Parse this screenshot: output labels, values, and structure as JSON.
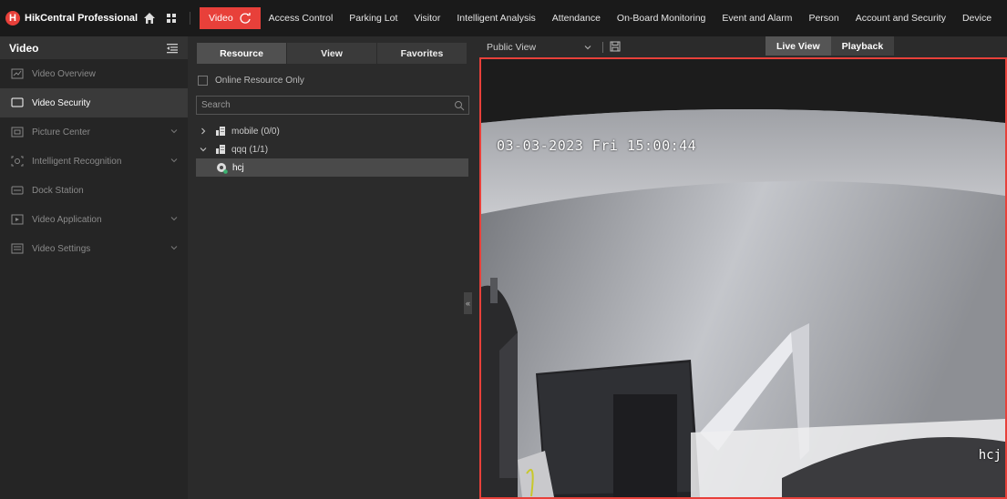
{
  "brand": {
    "logo_glyph": "H",
    "name": "HikCentral Professional"
  },
  "nav": {
    "active": "Video",
    "items": [
      "Access Control",
      "Parking Lot",
      "Visitor",
      "Intelligent Analysis",
      "Attendance",
      "On-Board Monitoring",
      "Event and Alarm",
      "Person",
      "Account and Security",
      "Device"
    ],
    "more": "···"
  },
  "sidebar": {
    "title": "Video",
    "items": [
      {
        "label": "Video Overview",
        "icon": "overview-icon",
        "expandable": false
      },
      {
        "label": "Video Security",
        "icon": "monitor-icon",
        "expandable": false,
        "active": true
      },
      {
        "label": "Picture Center",
        "icon": "picture-icon",
        "expandable": true
      },
      {
        "label": "Intelligent Recognition",
        "icon": "recognition-icon",
        "expandable": true
      },
      {
        "label": "Dock Station",
        "icon": "dock-icon",
        "expandable": false
      },
      {
        "label": "Video Application",
        "icon": "application-icon",
        "expandable": true
      },
      {
        "label": "Video Settings",
        "icon": "settings-icon",
        "expandable": true
      }
    ]
  },
  "resource": {
    "tabs": [
      "Resource",
      "View",
      "Favorites"
    ],
    "online_only": "Online Resource Only",
    "search_placeholder": "Search",
    "tree": [
      {
        "label": "mobile (0/0)"
      },
      {
        "label": "qqq (1/1)"
      },
      {
        "label": "hcj"
      }
    ]
  },
  "viewbar": {
    "view_name": "Public View",
    "live": "Live View",
    "playback": "Playback"
  },
  "video": {
    "osd_time": "03-03-2023 Fri 15:00:44",
    "osd_name": "hcj"
  },
  "colors": {
    "accent": "#e8403a",
    "bg": "#2b2b2b",
    "topbar": "#1a1a1a"
  }
}
